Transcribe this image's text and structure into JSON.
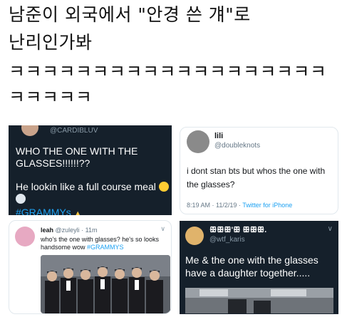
{
  "headline": {
    "line1": "남준이 외국에서 \"안경 쓴 걔\"로",
    "line2": "난리인가봐",
    "line3": "ㅋㅋㅋㅋㅋㅋㅋㅋㅋㅋㅋㅋㅋㅋㅋㅋㅋㅋㅋ",
    "line4": "ㅋㅋㅋㅋㅋ"
  },
  "tweet_a": {
    "handle": "@CARDIBLUV",
    "text1": "WHO THE ONE WITH THE GLASSES!!!!!!??",
    "text2": "He lookin like a full course meal",
    "hashtag": "#GRAMMYs",
    "theme_bg": "#15202b"
  },
  "tweet_b": {
    "name": "lili",
    "handle": "@doubleknots",
    "text": "i dont stan bts but whos the one with the glasses?",
    "time": "8:19 AM · 11/2/19 · ",
    "source": "Twitter for iPhone"
  },
  "tweet_c": {
    "name": "leah",
    "handle": "@zuleyli · 11m",
    "text": "who's the one with glasses? he's so looks handsome wow ",
    "hashtag": "#GRAMMYS",
    "chevron": "∨"
  },
  "tweet_d": {
    "name": "ꕥꕥꕥ'ꕥ ꕥꕥꕥ.",
    "handle": "@wtf_karis",
    "text": "Me & the one with the glasses have a daughter together.....",
    "chevron": "∨",
    "theme_bg": "#15202b"
  },
  "colors": {
    "link": "#1da1f2",
    "muted": "#657786"
  }
}
